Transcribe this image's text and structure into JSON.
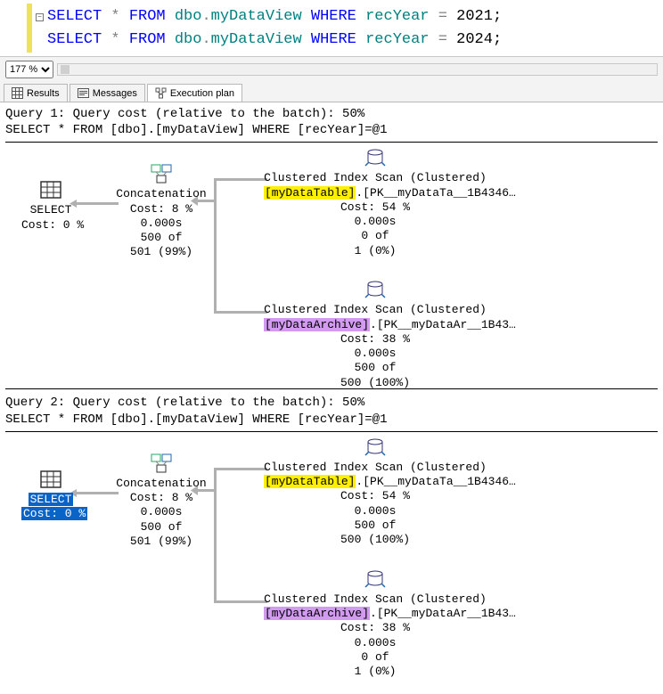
{
  "sql": {
    "line1_parts": [
      "SELECT",
      " * ",
      "FROM",
      " dbo",
      ".",
      "myDataView ",
      "WHERE",
      " recYear ",
      "=",
      " 2021",
      ";"
    ],
    "line2_parts": [
      "SELECT",
      " * ",
      "FROM",
      " dbo",
      ".",
      "myDataView ",
      "WHERE",
      " recYear ",
      "=",
      " 2024",
      ";"
    ]
  },
  "zoom": {
    "value": "177 %"
  },
  "tabs": {
    "results": "Results",
    "messages": "Messages",
    "execplan": "Execution plan"
  },
  "plan1": {
    "header_line1": "Query 1: Query cost (relative to the batch): 50%",
    "header_line2": "SELECT * FROM [dbo].[myDataView] WHERE [recYear]=@1",
    "select": {
      "title": "SELECT",
      "cost": "Cost: 0 %"
    },
    "concat": {
      "title": "Concatenation",
      "cost": "Cost: 8 %",
      "time": "0.000s",
      "rows1": "500 of",
      "rows2": "501 (99%)"
    },
    "scan1": {
      "title": "Clustered Index Scan (Clustered)",
      "table": "[myDataTable]",
      "tail": ".[PK__myDataTa__1B4346…",
      "cost": "Cost: 54 %",
      "time": "0.000s",
      "rows1": "0 of",
      "rows2": "1 (0%)"
    },
    "scan2": {
      "title": "Clustered Index Scan (Clustered)",
      "table": "[myDataArchive]",
      "tail": ".[PK__myDataAr__1B43…",
      "cost": "Cost: 38 %",
      "time": "0.000s",
      "rows1": "500 of",
      "rows2": "500 (100%)"
    }
  },
  "plan2": {
    "header_line1": "Query 2: Query cost (relative to the batch): 50%",
    "header_line2": "SELECT * FROM [dbo].[myDataView] WHERE [recYear]=@1",
    "select": {
      "title": "SELECT",
      "cost": "Cost: 0 %"
    },
    "concat": {
      "title": "Concatenation",
      "cost": "Cost: 8 %",
      "time": "0.000s",
      "rows1": "500 of",
      "rows2": "501 (99%)"
    },
    "scan1": {
      "title": "Clustered Index Scan (Clustered)",
      "table": "[myDataTable]",
      "tail": ".[PK__myDataTa__1B4346…",
      "cost": "Cost: 54 %",
      "time": "0.000s",
      "rows1": "500 of",
      "rows2": "500 (100%)"
    },
    "scan2": {
      "title": "Clustered Index Scan (Clustered)",
      "table": "[myDataArchive]",
      "tail": ".[PK__myDataAr__1B43…",
      "cost": "Cost: 38 %",
      "time": "0.000s",
      "rows1": "0 of",
      "rows2": "1 (0%)"
    }
  }
}
